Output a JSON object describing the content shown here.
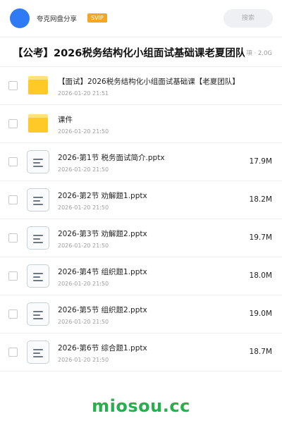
{
  "header": {
    "user_name": "夸克网盘分享",
    "badge": "SVIP",
    "search_label": "搜索"
  },
  "folder": {
    "title": "【公考】2026税务结构化小组面试基础课老夏团队",
    "meta": "項 · 2.0G"
  },
  "files": [
    {
      "type": "folder",
      "name": "【面试】2026税务结构化小组面试基础课【老夏团队】",
      "date": "2026-01-20 21:51",
      "size": ""
    },
    {
      "type": "folder",
      "name": "课件",
      "date": "2026-01-20 21:50",
      "size": ""
    },
    {
      "type": "document",
      "name": "2026-第1节 税务面试简介.pptx",
      "date": "2026-01-20 21:50",
      "size": "17.9M"
    },
    {
      "type": "document",
      "name": "2026-第2节 劝解题1.pptx",
      "date": "2026-01-20 21:50",
      "size": "18.2M"
    },
    {
      "type": "document",
      "name": "2026-第3节 劝解题2.pptx",
      "date": "2026-01-20 21:50",
      "size": "19.7M"
    },
    {
      "type": "document",
      "name": "2026-第4节 组织题1.pptx",
      "date": "2026-01-20 21:50",
      "size": "18.0M"
    },
    {
      "type": "document",
      "name": "2026-第5节 组织题2.pptx",
      "date": "2026-01-20 21:50",
      "size": "19.0M"
    },
    {
      "type": "document",
      "name": "2026-第6节 综合题1.pptx",
      "date": "2026-01-20 21:50",
      "size": "18.7M"
    }
  ],
  "watermark": "miosou.cc",
  "colors": {
    "avatar": "#2f7bf6",
    "svip_badge": "#f5a623",
    "folder": "#ffc928",
    "watermark": "#22b14c"
  }
}
